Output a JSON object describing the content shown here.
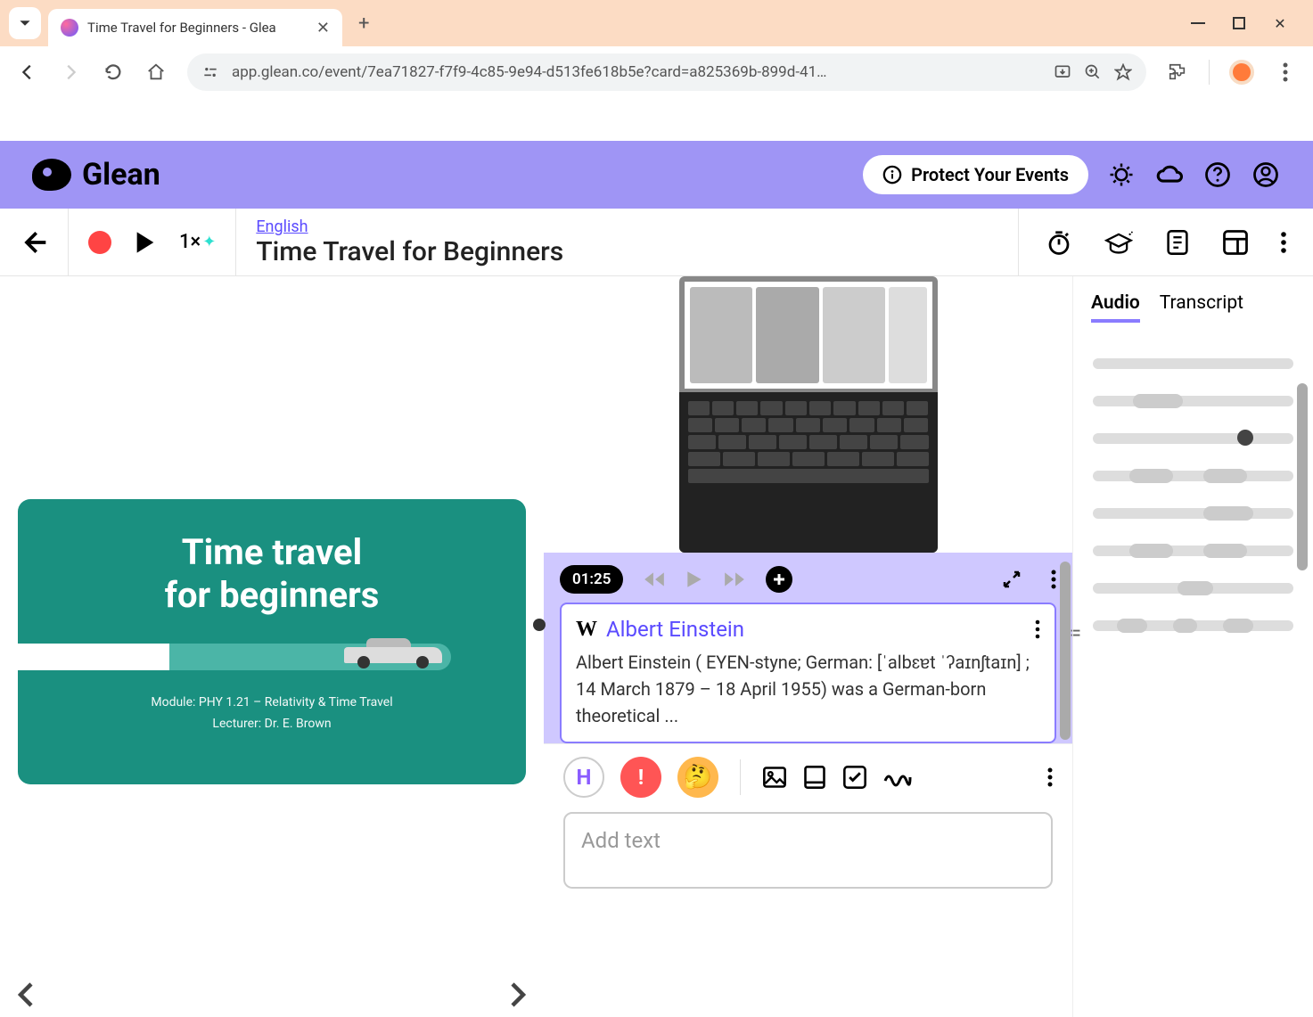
{
  "browser": {
    "tab_title": "Time Travel for Beginners - Glea",
    "url": "app.glean.co/event/7ea71827-f7f9-4c85-9e94-d513fe618b5e?card=a825369b-899d-41…"
  },
  "app_header": {
    "logo_text": "Glean",
    "protect_label": "Protect Your Events"
  },
  "event_toolbar": {
    "speed_label": "1×",
    "language_link": "English",
    "event_title": "Time Travel for Beginners"
  },
  "slide": {
    "title_line1": "Time travel",
    "title_line2": "for beginners",
    "module": "Module: PHY 1.21 – Relativity & Time Travel",
    "lecturer": "Lecturer: Dr. E. Brown"
  },
  "card": {
    "timestamp": "01:25",
    "wiki_title": "Albert Einstein",
    "wiki_body": "Albert Einstein ( EYEN-styne; German: [ˈalbɛɐt ˈʔaɪnʃtaɪn] ; 14 March 1879 – 18 April 1955) was a German-born theoretical ..."
  },
  "compose": {
    "placeholder": "Add text",
    "heading_letter": "H",
    "exclaim": "!",
    "think_emoji": "🤔"
  },
  "right_panel": {
    "tab_audio": "Audio",
    "tab_transcript": "Transcript"
  },
  "colors": {
    "brand_purple": "#9f95f5",
    "accent_teal": "#1a9080",
    "record_red": "#ff4444"
  }
}
